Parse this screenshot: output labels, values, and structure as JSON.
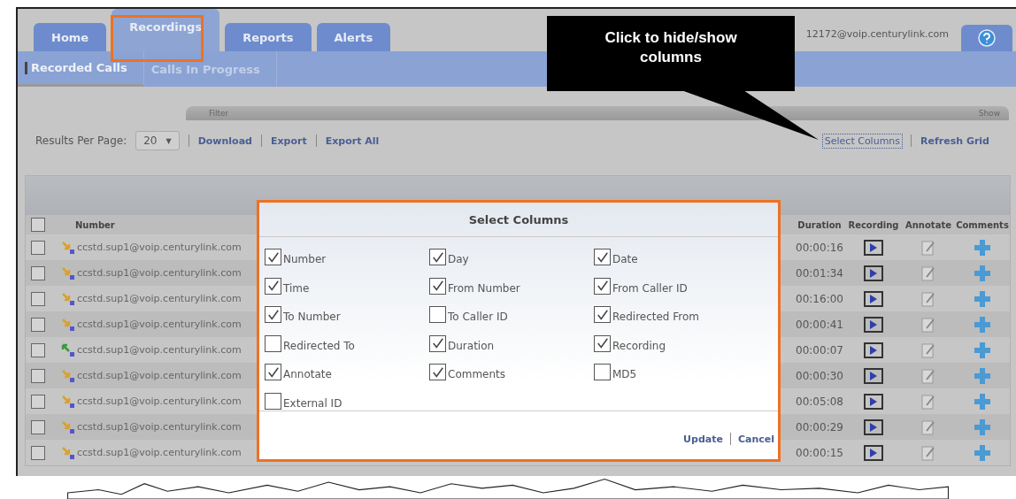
{
  "tabs": [
    {
      "label": "Home",
      "selected": false
    },
    {
      "label": "Recordings",
      "selected": true
    },
    {
      "label": "Reports",
      "selected": false
    },
    {
      "label": "Alerts",
      "selected": false
    }
  ],
  "user": "12172@voip.centurylink.com",
  "subtabs": [
    {
      "label": "Recorded Calls",
      "selected": true
    },
    {
      "label": "Calls In Progress",
      "selected": false
    }
  ],
  "filter": {
    "label": "Filter",
    "show_label": "Show"
  },
  "results": {
    "label": "Results Per Page:",
    "value": "20",
    "caret": "▼"
  },
  "links": [
    "Download",
    "Export",
    "Export All"
  ],
  "grid_links": [
    "Select Columns",
    "Refresh Grid"
  ],
  "table": {
    "select_all_checked": false,
    "columns": [
      "Number",
      "Duration",
      "Recording",
      "Annotate",
      "Comments"
    ],
    "rows": [
      {
        "checked": false,
        "kind": "outgoing",
        "number": "ccstd.sup1@voip.centurylink.com",
        "duration": "00:00:16"
      },
      {
        "checked": false,
        "kind": "outgoing",
        "number": "ccstd.sup1@voip.centurylink.com",
        "duration": "00:01:34"
      },
      {
        "checked": false,
        "kind": "outgoing",
        "number": "ccstd.sup1@voip.centurylink.com",
        "duration": "00:16:00"
      },
      {
        "checked": false,
        "kind": "outgoing",
        "number": "ccstd.sup1@voip.centurylink.com",
        "duration": "00:00:41"
      },
      {
        "checked": false,
        "kind": "incoming",
        "number": "ccstd.sup1@voip.centurylink.com",
        "duration": "00:00:07"
      },
      {
        "checked": false,
        "kind": "outgoing",
        "number": "ccstd.sup1@voip.centurylink.com",
        "duration": "00:00:30"
      },
      {
        "checked": false,
        "kind": "outgoing",
        "number": "ccstd.sup1@voip.centurylink.com",
        "duration": "00:05:08"
      },
      {
        "checked": false,
        "kind": "outgoing",
        "number": "ccstd.sup1@voip.centurylink.com",
        "duration": "00:00:29"
      },
      {
        "checked": false,
        "kind": "outgoing",
        "number": "ccstd.sup1@voip.centurylink.com",
        "duration": "00:00:15"
      }
    ]
  },
  "dialog": {
    "title": "Select Columns",
    "options": [
      {
        "label": "Number",
        "checked": true
      },
      {
        "label": "Day",
        "checked": true
      },
      {
        "label": "Date",
        "checked": true
      },
      {
        "label": "Time",
        "checked": true
      },
      {
        "label": "From Number",
        "checked": true
      },
      {
        "label": "From Caller ID",
        "checked": true
      },
      {
        "label": "To Number",
        "checked": true
      },
      {
        "label": "To Caller ID",
        "checked": false
      },
      {
        "label": "Redirected From",
        "checked": true
      },
      {
        "label": "Redirected To",
        "checked": false
      },
      {
        "label": "Duration",
        "checked": true
      },
      {
        "label": "Recording",
        "checked": true
      },
      {
        "label": "Annotate",
        "checked": true
      },
      {
        "label": "Comments",
        "checked": true
      },
      {
        "label": "MD5",
        "checked": false
      },
      {
        "label": "External ID",
        "checked": false
      }
    ],
    "buttons": [
      "Update",
      "Cancel"
    ]
  },
  "callout": {
    "text": "Click to hide/show columns"
  }
}
